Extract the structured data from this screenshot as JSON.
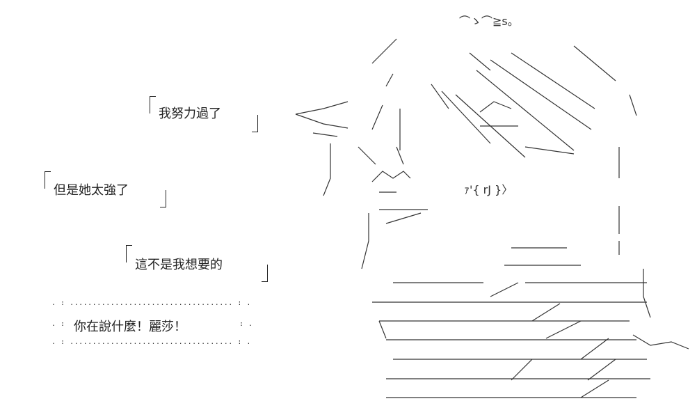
{
  "bubbles": [
    {
      "text": "我努力過了"
    },
    {
      "text": "但是她太強了"
    },
    {
      "text": "這不是我想要的"
    }
  ],
  "shout": {
    "dots_top": ". : .................................... : .",
    "left_marks": ". :",
    "text": "你在說什麼！麗莎！",
    "right_marks": ": .",
    "dots_bottom": ". : .................................... : ."
  },
  "art_labels": {
    "sigh": "⌒ゝ⌒≧s。",
    "face": "ｧ'{ rJ }〉"
  }
}
